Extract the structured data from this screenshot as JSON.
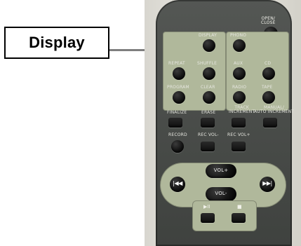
{
  "callout": {
    "label": "Display"
  },
  "remote": {
    "top_right_button": {
      "label": "OPEN/\nCLOSE"
    },
    "left_panel": {
      "buttons": [
        {
          "label": "DISPLAY"
        },
        {
          "label": "REPEAT"
        },
        {
          "label": "SHUFFLE"
        },
        {
          "label": "PROGRAM"
        },
        {
          "label": "CLEAR"
        }
      ]
    },
    "right_panel": {
      "buttons": [
        {
          "label": "PHONO"
        },
        {
          "label": "AUX"
        },
        {
          "label": "CD"
        },
        {
          "label": "RADIO"
        },
        {
          "label": "TAPE"
        }
      ]
    },
    "middle_row": {
      "buttons": [
        {
          "label": "FINALIZE"
        },
        {
          "label": "ERASE"
        },
        {
          "label": "TRACK\nINCREMENT"
        },
        {
          "label": "MANUAL/\nAUTO INCREMENT"
        }
      ]
    },
    "record_row": {
      "buttons": [
        {
          "label": "RECORD"
        },
        {
          "label": "REC VOL-"
        },
        {
          "label": "REC VOL+"
        }
      ]
    },
    "nav": {
      "vol_plus": "VOL+",
      "vol_minus": "VOL-",
      "prev": "|◀◀",
      "next": "▶▶|"
    },
    "bottom_controls": {
      "play_pause": "▶II",
      "stop": "■"
    }
  }
}
